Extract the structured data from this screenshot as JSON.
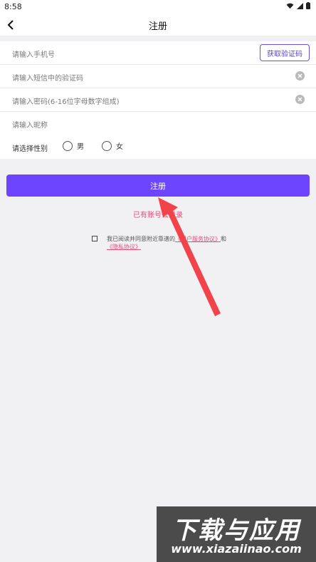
{
  "status": {
    "time": "8:58"
  },
  "header": {
    "title": "注册"
  },
  "form": {
    "phone_placeholder": "请输入手机号",
    "code_button": "获取验证码",
    "sms_placeholder": "请输入短信中的验证码",
    "password_placeholder": "请输入密码(6-16位字母数字组成)",
    "nickname_placeholder": "请输入昵称",
    "gender_label": "请选择性别",
    "gender_male": "男",
    "gender_female": "女"
  },
  "actions": {
    "register_label": "注册",
    "login_link": "已有账号去登录"
  },
  "agreement": {
    "prefix": "我已阅读并同意附近靠谱的",
    "user_agreement": "《用户服务协议》",
    "and": "和",
    "privacy_agreement": "《隐私协议》"
  },
  "watermark": {
    "title": "下载与应用",
    "url": "www.xiazaiinao.com"
  },
  "colors": {
    "accent": "#6d45ff",
    "link": "#e0507a",
    "arrow": "#f2434b"
  }
}
